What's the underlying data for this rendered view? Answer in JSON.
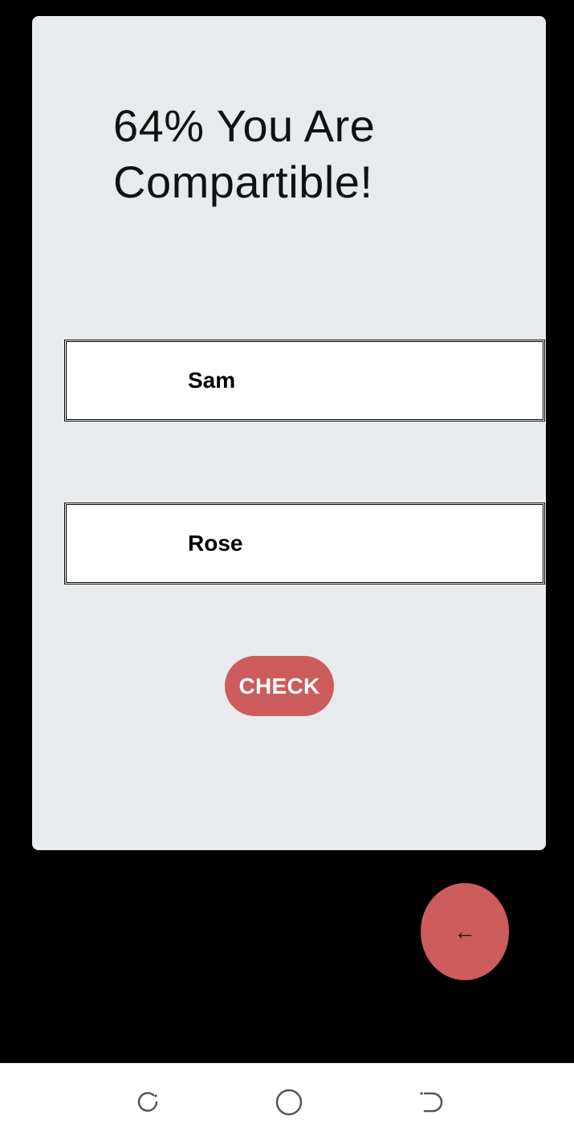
{
  "result": {
    "percentage": "64%",
    "title": "64% You Are Compartible!"
  },
  "form": {
    "name1_value": "Sam",
    "name2_value": "Rose",
    "check_label": "CHECK"
  },
  "fab": {
    "icon": "arrow-left-icon",
    "glyph": "←"
  },
  "navbar": {
    "recent_icon": "recent-apps-icon",
    "home_icon": "home-icon",
    "back_icon": "back-icon"
  },
  "colors": {
    "accent": "#cd5c5c",
    "card_background": "#e8ebee",
    "page_background": "#000000"
  }
}
